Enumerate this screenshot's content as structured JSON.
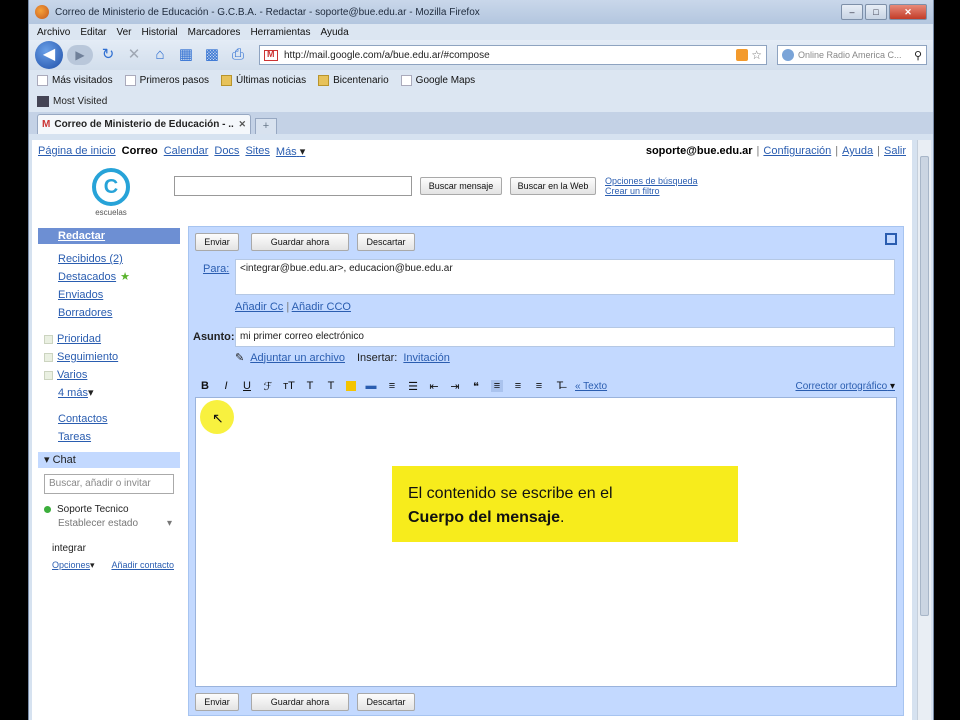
{
  "browser": {
    "title": "Correo de Ministerio de Educación - G.C.B.A. - Redactar - soporte@bue.edu.ar - Mozilla Firefox",
    "menu": [
      "Archivo",
      "Editar",
      "Ver",
      "Historial",
      "Marcadores",
      "Herramientas",
      "Ayuda"
    ],
    "url": "http://mail.google.com/a/bue.edu.ar/#compose",
    "search_placeholder": "Online Radio America C...",
    "bookmarks": [
      {
        "label": "Más visitados",
        "icon": "page-icon"
      },
      {
        "label": "Primeros pasos",
        "icon": "page-icon"
      },
      {
        "label": "Últimas noticias",
        "icon": "rss-folder-icon"
      },
      {
        "label": "Bicentenario",
        "icon": "folder-icon"
      },
      {
        "label": "Google Maps",
        "icon": "page-icon"
      }
    ],
    "most_visited": "Most Visited",
    "tab_label": "Correo de Ministerio de Educación - ...",
    "newtab": "+"
  },
  "gbar": {
    "links": [
      "Página de inicio",
      "Correo",
      "Calendar",
      "Docs",
      "Sites",
      "Más"
    ],
    "more_arrow": "▾",
    "email": "soporte@bue.edu.ar",
    "settings": "Configuración",
    "help": "Ayuda",
    "logout": "Salir"
  },
  "header": {
    "logo_letter": "C",
    "logo_text": "escuelas",
    "search_mail_btn": "Buscar mensaje",
    "search_web_btn": "Buscar en la Web",
    "search_options": "Opciones de búsqueda",
    "create_filter": "Crear un filtro"
  },
  "leftnav": {
    "compose": "Redactar",
    "inbox": "Recibidos (2)",
    "starred": "Destacados",
    "sent": "Enviados",
    "drafts": "Borradores",
    "labels": [
      "Prioridad",
      "Seguimiento",
      "Varios"
    ],
    "more": "4 más",
    "contacts": "Contactos",
    "tasks": "Tareas"
  },
  "chat": {
    "title": "Chat",
    "search_placeholder": "Buscar, añadir o invitar",
    "me": "Soporte Tecnico",
    "status": "Establecer estado",
    "contact": "integrar",
    "options": "Opciones",
    "add_contact": "Añadir contacto"
  },
  "compose": {
    "send": "Enviar",
    "save": "Guardar ahora",
    "discard": "Descartar",
    "to_label": "Para:",
    "to_value": "<integrar@bue.edu.ar>, educacion@bue.edu.ar",
    "add_cc": "Añadir Cc",
    "add_bcc": "Añadir CCO",
    "subject_label": "Asunto:",
    "subject_value": "mi primer correo electrónico",
    "attach": "Adjuntar un archivo",
    "insert": "Insertar:",
    "invitation": "Invitación",
    "plain_text": "« Texto",
    "spellcheck": "Corrector ortográfico"
  },
  "callout": {
    "line1": "El contenido se escribe en el",
    "line2": "Cuerpo del mensaje",
    "line2_suffix": "."
  },
  "colors": {
    "gmail_blue": "#c3d9ff",
    "link": "#2a5db0",
    "callout": "#f7ec1c"
  }
}
